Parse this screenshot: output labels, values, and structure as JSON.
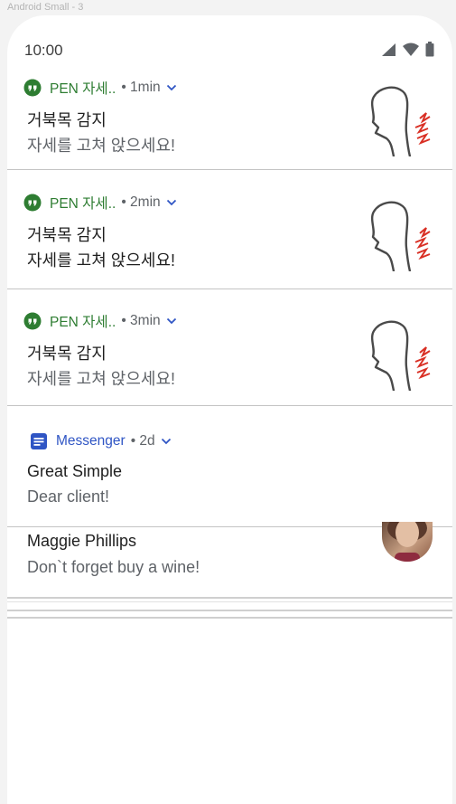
{
  "frame_label": "Android Small - 3",
  "status_bar": {
    "time": "10:00",
    "icons": [
      "signal-icon",
      "wifi-icon",
      "battery-icon"
    ]
  },
  "colors": {
    "pen_accent": "#2e7d32",
    "messenger_accent": "#2f55c4",
    "alert_red": "#d93025"
  },
  "notifications": [
    {
      "app": "PEN 자세..",
      "time": "• 1min",
      "title": "거북목 감지",
      "body": "자세를 고쳐 앉으세요!",
      "icon": "quote-bubble-icon",
      "art": "posture-head-icon"
    },
    {
      "app": "PEN 자세..",
      "time": "• 2min",
      "title": "거북목 감지",
      "body": "자세를 고쳐 앉으세요!",
      "icon": "quote-bubble-icon",
      "art": "posture-head-icon"
    },
    {
      "app": "PEN 자세..",
      "time": "• 3min",
      "title": "거북목 감지",
      "body": "자세를 고쳐 앉으세요!",
      "icon": "quote-bubble-icon",
      "art": "posture-head-icon"
    },
    {
      "app": "Messenger",
      "time": "• 2d",
      "title": "Great Simple",
      "body": "Dear client!",
      "icon": "message-icon"
    },
    {
      "title": "Maggie Phillips",
      "body": "Don`t forget buy a wine!",
      "avatar": "avatar"
    }
  ]
}
